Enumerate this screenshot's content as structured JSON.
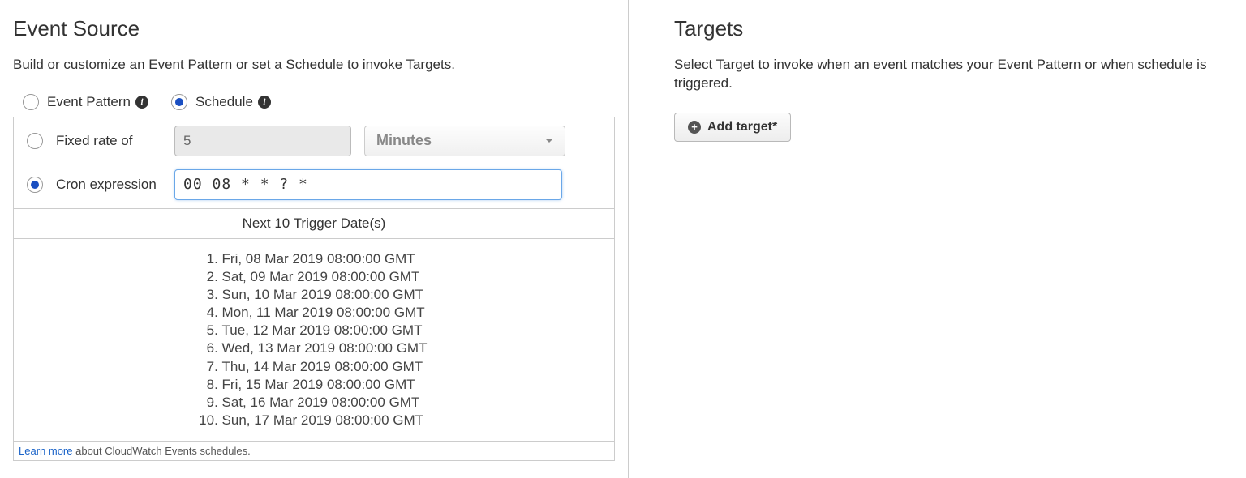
{
  "eventSource": {
    "title": "Event Source",
    "description": "Build or customize an Event Pattern or set a Schedule to invoke Targets.",
    "modeRadios": {
      "eventPattern": "Event Pattern",
      "schedule": "Schedule"
    },
    "fixedRate": {
      "label": "Fixed rate of",
      "value": "5",
      "unit": "Minutes"
    },
    "cron": {
      "label": "Cron expression",
      "value": "00 08 * * ? *"
    },
    "nextTriggersHeader": "Next 10 Trigger Date(s)",
    "nextTriggers": [
      "Fri, 08 Mar 2019 08:00:00 GMT",
      "Sat, 09 Mar 2019 08:00:00 GMT",
      "Sun, 10 Mar 2019 08:00:00 GMT",
      "Mon, 11 Mar 2019 08:00:00 GMT",
      "Tue, 12 Mar 2019 08:00:00 GMT",
      "Wed, 13 Mar 2019 08:00:00 GMT",
      "Thu, 14 Mar 2019 08:00:00 GMT",
      "Fri, 15 Mar 2019 08:00:00 GMT",
      "Sat, 16 Mar 2019 08:00:00 GMT",
      "Sun, 17 Mar 2019 08:00:00 GMT"
    ],
    "learnMore": {
      "link": "Learn more",
      "text": "about CloudWatch Events schedules."
    }
  },
  "targets": {
    "title": "Targets",
    "description": "Select Target to invoke when an event matches your Event Pattern or when schedule is triggered.",
    "addButton": "Add target*"
  }
}
